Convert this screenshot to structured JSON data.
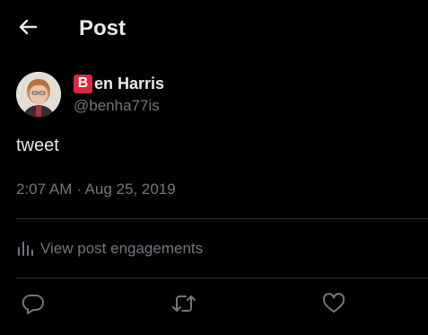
{
  "header": {
    "back_icon": "arrow-left-icon",
    "title": "Post"
  },
  "author": {
    "badge_letter": "B",
    "name_rest": "en Harris",
    "handle": "@benha77is"
  },
  "post": {
    "text": "tweet",
    "timestamp": "2:07 AM · Aug 25, 2019"
  },
  "engagements": {
    "icon": "bar-chart-icon",
    "label": "View post engagements"
  },
  "actions": [
    {
      "icon": "reply-icon"
    },
    {
      "icon": "retweet-icon"
    },
    {
      "icon": "like-icon"
    }
  ],
  "colors": {
    "background": "#000000",
    "primary_text": "#e7e9ea",
    "secondary_text": "#71767b",
    "divider": "#2f3336",
    "badge": "#d92a3d"
  }
}
